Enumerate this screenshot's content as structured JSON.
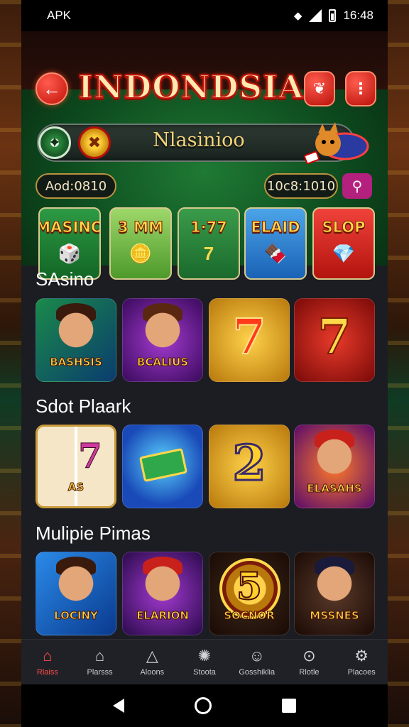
{
  "status_bar": {
    "app": "APK",
    "time": "16:48"
  },
  "header": {
    "title": "INDONDSIA",
    "back_icon": "←",
    "logo_icon": "❦",
    "menu_icon": "⋮"
  },
  "promo": {
    "text": "Nlasinioo"
  },
  "balances": {
    "left": "Aod:0810",
    "right": "10c8:1010",
    "search_icon": "⚲"
  },
  "categories": [
    {
      "label": "MASINO",
      "art": "🎲"
    },
    {
      "label": "3 MM",
      "art": "🪙"
    },
    {
      "label": "1·77",
      "art": "7"
    },
    {
      "label": "ELAID",
      "art": "🍫"
    },
    {
      "label": "SLOP",
      "art": "💎"
    }
  ],
  "sections": [
    {
      "title": "SAsino",
      "tiles": [
        "BASHSIS",
        "BCALIUS",
        "",
        ""
      ],
      "numerals": [
        "",
        "",
        "7",
        "7"
      ]
    },
    {
      "title": "Sdot Plaark",
      "tiles": [
        "AS",
        "",
        "",
        "ELASAHS"
      ],
      "numerals": [
        "7",
        "",
        "2",
        ""
      ]
    },
    {
      "title": "Mulipie Pimas",
      "tiles": [
        "LOCINY",
        "ELARION",
        "SOCNOR",
        "MSSNES"
      ],
      "numerals": [
        "",
        "",
        "5",
        ""
      ]
    }
  ],
  "bottom_nav": [
    {
      "label": "Rlaiss",
      "icon": "⌂",
      "active": true
    },
    {
      "label": "Plarsss",
      "icon": "⌂",
      "active": false
    },
    {
      "label": "Aloons",
      "icon": "△",
      "active": false
    },
    {
      "label": "Stoota",
      "icon": "✺",
      "active": false
    },
    {
      "label": "Gosshiklia",
      "icon": "☺",
      "active": false
    },
    {
      "label": "Rlotle",
      "icon": "⊙",
      "active": false
    },
    {
      "label": "Placoes",
      "icon": "⚙",
      "active": false
    }
  ],
  "colors": {
    "accent": "#ff4b4b",
    "background": "#1c1d22",
    "felt": "#1f7a34",
    "gold": "#ffd84a"
  }
}
